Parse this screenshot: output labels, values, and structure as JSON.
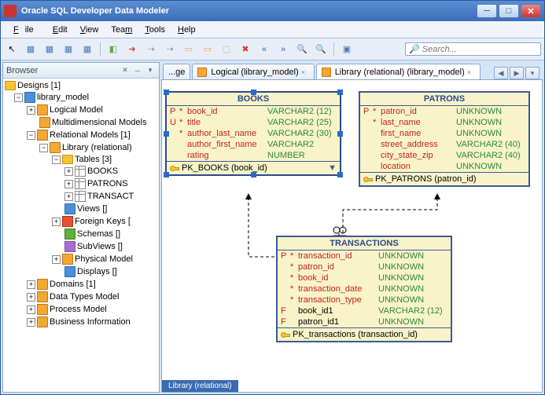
{
  "title": "Oracle SQL Developer Data Modeler",
  "menu": {
    "file": "File",
    "edit": "Edit",
    "view": "View",
    "team": "Team",
    "tools": "Tools",
    "help": "Help"
  },
  "search": {
    "placeholder": "Search..."
  },
  "browser": {
    "title": "Browser",
    "designs": "Designs [1]",
    "model": "library_model",
    "items": {
      "logical": "Logical Model",
      "multi": "Multidimensional Models",
      "relational": "Relational Models [1]",
      "library": "Library (relational)",
      "tables": "Tables [3]",
      "books": "BOOKS",
      "patrons": "PATRONS",
      "transact": "TRANSACT",
      "views": "Views []",
      "fkeys": "Foreign Keys [",
      "schemas": "Schemas []",
      "subviews": "SubViews []",
      "physical": "Physical Model",
      "displays": "Displays []",
      "domains": "Domains [1]",
      "datatypes": "Data Types Model",
      "process": "Process Model",
      "business": "Business Information"
    }
  },
  "tabs": {
    "t1": "...ge",
    "t2": "Logical (library_model)",
    "t3": "Library (relational) (library_model)"
  },
  "entities": {
    "books": {
      "title": "BOOKS",
      "cols": [
        {
          "flag": "P",
          "star": "*",
          "name": "book_id",
          "type": "VARCHAR2 (12)"
        },
        {
          "flag": "U",
          "star": "*",
          "name": "title",
          "type": "VARCHAR2 (25)"
        },
        {
          "flag": "",
          "star": "*",
          "name": "author_last_name",
          "type": "VARCHAR2 (30)"
        },
        {
          "flag": "",
          "star": "",
          "name": "author_first_name",
          "type": "VARCHAR2"
        },
        {
          "flag": "",
          "star": "",
          "name": "rating",
          "type": "NUMBER"
        }
      ],
      "pk": "PK_BOOKS (book_id)"
    },
    "patrons": {
      "title": "PATRONS",
      "cols": [
        {
          "flag": "P",
          "star": "*",
          "name": "patron_id",
          "type": "UNKNOWN"
        },
        {
          "flag": "",
          "star": "*",
          "name": "last_name",
          "type": "UNKNOWN"
        },
        {
          "flag": "",
          "star": "",
          "name": "first_name",
          "type": "UNKNOWN"
        },
        {
          "flag": "",
          "star": "",
          "name": "street_address",
          "type": "VARCHAR2 (40)"
        },
        {
          "flag": "",
          "star": "",
          "name": "city_state_zip",
          "type": "VARCHAR2 (40)"
        },
        {
          "flag": "",
          "star": "",
          "name": "location",
          "type": "UNKNOWN"
        }
      ],
      "pk": "PK_PATRONS (patron_id)"
    },
    "transactions": {
      "title": "TRANSACTIONS",
      "cols": [
        {
          "flag": "P",
          "star": "*",
          "name": "transaction_id",
          "type": "UNKNOWN"
        },
        {
          "flag": "",
          "star": "*",
          "name": "patron_id",
          "type": "UNKNOWN"
        },
        {
          "flag": "",
          "star": "*",
          "name": "book_id",
          "type": "UNKNOWN"
        },
        {
          "flag": "",
          "star": "*",
          "name": "transaction_date",
          "type": "UNKNOWN"
        },
        {
          "flag": "",
          "star": "*",
          "name": "transaction_type",
          "type": "UNKNOWN"
        },
        {
          "flag": "F",
          "star": "",
          "name": "book_id1",
          "type": "VARCHAR2 (12)",
          "black": true
        },
        {
          "flag": "F",
          "star": "",
          "name": "patron_id1",
          "type": "UNKNOWN",
          "black": true
        }
      ],
      "pk": "PK_transactions (transaction_id)"
    }
  },
  "bottom_tab": "Library (relational)"
}
